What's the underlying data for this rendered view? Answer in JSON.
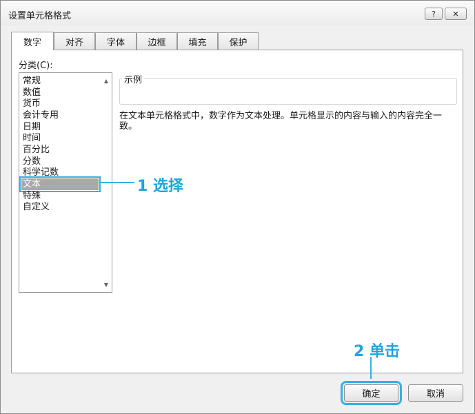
{
  "window": {
    "title": "设置单元格格式",
    "help_label": "?",
    "close_label": "✕"
  },
  "tabs": [
    {
      "label": "数字",
      "active": true
    },
    {
      "label": "对齐"
    },
    {
      "label": "字体"
    },
    {
      "label": "边框"
    },
    {
      "label": "填充"
    },
    {
      "label": "保护"
    }
  ],
  "category": {
    "label": "分类(C):",
    "items": [
      "常规",
      "数值",
      "货币",
      "会计专用",
      "日期",
      "时间",
      "百分比",
      "分数",
      "科学记数",
      "文本",
      "特殊",
      "自定义"
    ],
    "selected": "文本"
  },
  "sample": {
    "label": "示例"
  },
  "description": "在文本单元格格式中，数字作为文本处理。单元格显示的内容与输入的内容完全一致。",
  "annotations": {
    "step1": "1 选择",
    "step2": "2 单击",
    "color": "#33b1e6"
  },
  "buttons": {
    "ok": "确定",
    "cancel": "取消"
  }
}
